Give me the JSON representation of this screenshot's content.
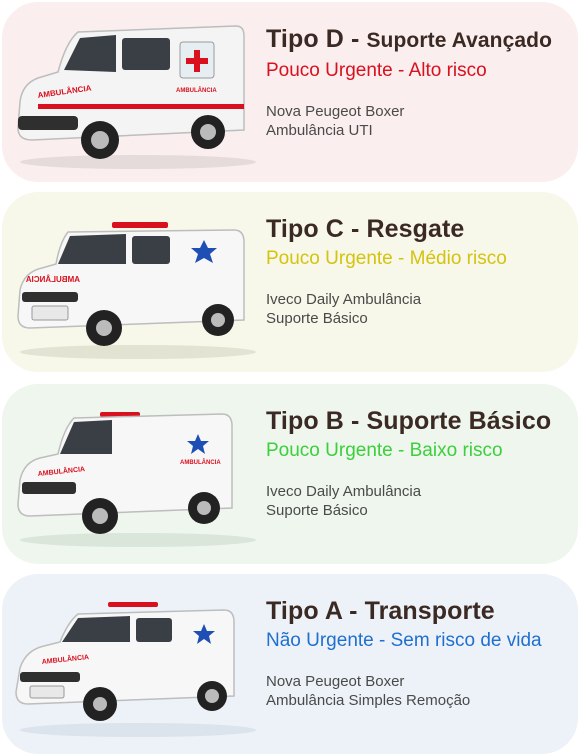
{
  "cards": [
    {
      "type": "Tipo D",
      "separator": " - ",
      "name": "Suporte Avançado",
      "urgency": "Pouco Urgente - Alto risco",
      "urgency_color": "#d9101e",
      "vehicle": "Nova Peugeot Boxer",
      "category": "Ambulância UTI",
      "van_label": "AMBULÂNCIA",
      "background": "#fbeeee"
    },
    {
      "type": "Tipo C",
      "separator": " - ",
      "name": "Resgate",
      "urgency": "Pouco Urgente - Médio risco",
      "urgency_color": "#d4c30f",
      "vehicle": "Iveco Daily Ambulância",
      "category": "Suporte Básico",
      "van_label": "AMBULÂNCIA",
      "background": "#f7f7ea"
    },
    {
      "type": "Tipo B",
      "separator": " - ",
      "name": "Suporte Básico",
      "urgency": "Pouco Urgente - Baixo risco",
      "urgency_color": "#3ccf3c",
      "vehicle": "Iveco Daily Ambulância",
      "category": "Suporte Básico",
      "van_label": "AMBULÂNCIA",
      "background": "#eef6ee"
    },
    {
      "type": "Tipo A",
      "separator": " - ",
      "name": "Transporte",
      "urgency": "Não Urgente - Sem risco de vida",
      "urgency_color": "#1f6fd1",
      "vehicle": "Nova Peugeot Boxer",
      "category": "Ambulância Simples Remoção",
      "van_label": "AMBULÂNCIA",
      "background": "#edf2f8"
    }
  ]
}
